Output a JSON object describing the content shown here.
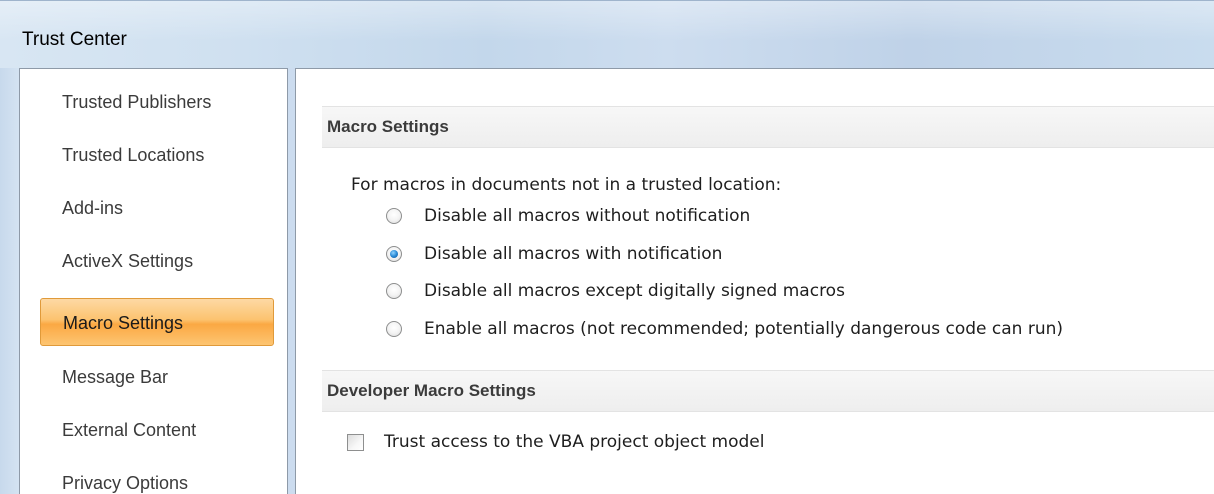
{
  "window": {
    "title": "Trust Center"
  },
  "sidebar": {
    "items": [
      {
        "label": "Trusted Publishers",
        "selected": false
      },
      {
        "label": "Trusted Locations",
        "selected": false
      },
      {
        "label": "Add-ins",
        "selected": false
      },
      {
        "label": "ActiveX Settings",
        "selected": false
      },
      {
        "label": "Macro Settings",
        "selected": true
      },
      {
        "label": "Message Bar",
        "selected": false
      },
      {
        "label": "External Content",
        "selected": false
      },
      {
        "label": "Privacy Options",
        "selected": false
      }
    ],
    "selected_color": "#fbb450"
  },
  "macro_settings": {
    "header": "Macro Settings",
    "prompt": "For macros in documents not in a trusted location:",
    "options": [
      {
        "label": "Disable all macros without notification",
        "checked": false
      },
      {
        "label": "Disable all macros with notification",
        "checked": true
      },
      {
        "label": "Disable all macros except digitally signed macros",
        "checked": false
      },
      {
        "label": "Enable all macros (not recommended; potentially dangerous code can run)",
        "checked": false
      }
    ]
  },
  "developer_macro_settings": {
    "header": "Developer Macro Settings",
    "trust_vba": {
      "label": "Trust access to the VBA project object model",
      "checked": false
    }
  }
}
